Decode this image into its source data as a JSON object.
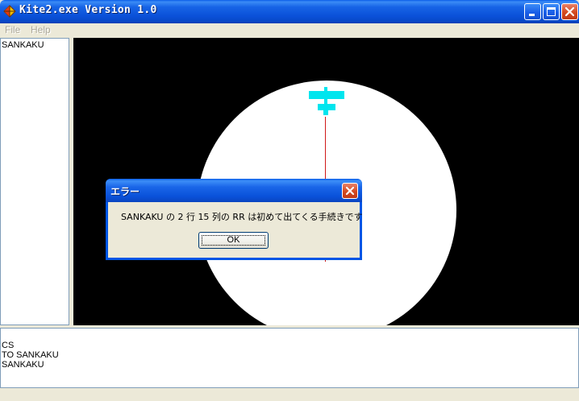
{
  "window": {
    "title": "Kite2.exe Version 1.0",
    "app_icon": "kite-app-icon"
  },
  "menu": {
    "items": [
      "File",
      "Help"
    ]
  },
  "procedures": {
    "items": [
      "SANKAKU"
    ]
  },
  "canvas": {
    "background_color": "#000000",
    "disc_color": "#ffffff",
    "kite_color": "#00e5ee",
    "string_color": "#d01818"
  },
  "command_area": {
    "lines": [
      "CS",
      "TO SANKAKU",
      "SANKAKU"
    ]
  },
  "dialog": {
    "title": "エラー",
    "message": "SANKAKU の 2 行 15 列の RR は初めて出てくる手続きです",
    "ok_label": "OK"
  }
}
